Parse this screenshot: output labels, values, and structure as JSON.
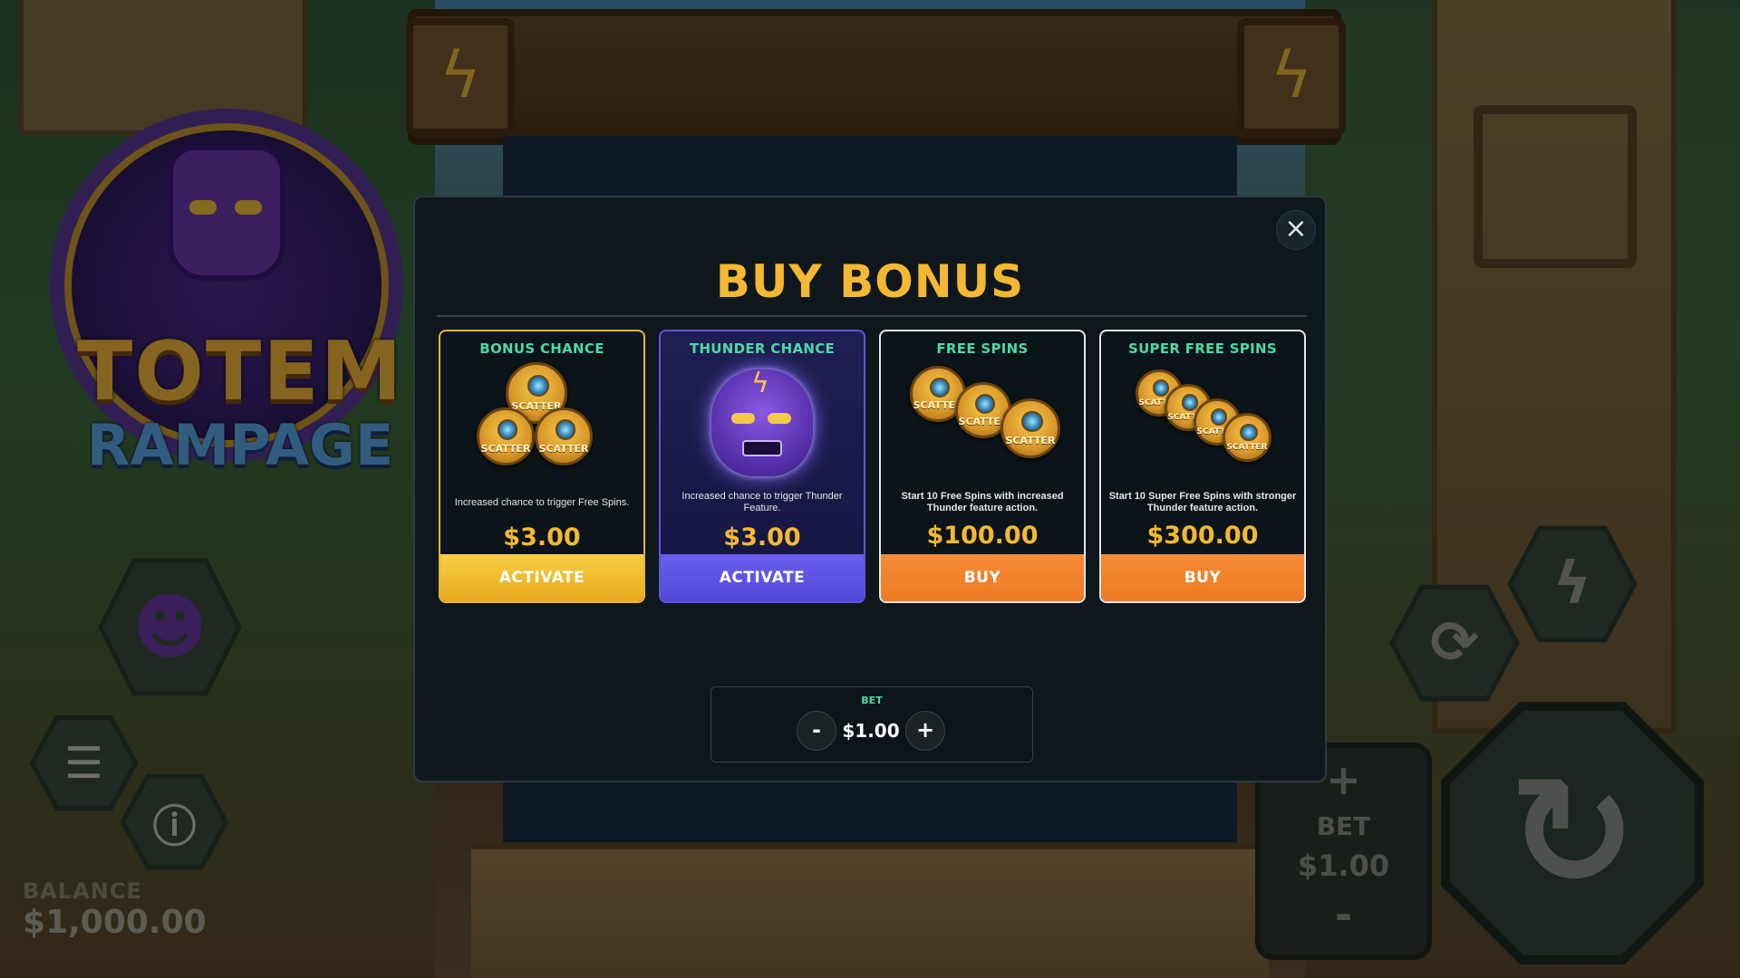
{
  "background": {
    "logo_line1": "TOTEM",
    "logo_line2": "RAMPAGE",
    "balance_label": "BALANCE",
    "balance_value": "$1,000.00",
    "bet_label": "BET",
    "bet_value": "$1.00",
    "bet_plus": "+",
    "bet_minus": "-"
  },
  "modal": {
    "title": "BUY BONUS",
    "close_icon": "×",
    "cards": [
      {
        "title": "BONUS CHANCE",
        "art": "scatter-coins-triangle-icon",
        "coin_labels": [
          "SCATTER",
          "SCATTER",
          "SCATTER"
        ],
        "description": "Increased chance to trigger Free Spins.",
        "price": "$3.00",
        "button": "ACTIVATE",
        "accent": "#e8b338"
      },
      {
        "title": "THUNDER CHANCE",
        "art": "thunder-totem-face-icon",
        "description": "Increased chance to trigger Thunder Feature.",
        "price": "$3.00",
        "button": "ACTIVATE",
        "accent": "#5e54e0"
      },
      {
        "title": "FREE SPINS",
        "art": "three-scatter-coins-icon",
        "coin_labels": [
          "SCATTER",
          "SCATTER",
          "SCATTER"
        ],
        "description": "Start 10 Free Spins with increased Thunder feature action.",
        "price": "$100.00",
        "button": "BUY",
        "accent": "#ee7a24"
      },
      {
        "title": "SUPER FREE SPINS",
        "art": "four-scatter-coins-icon",
        "coin_labels": [
          "SCATTER",
          "SCATTER",
          "SCATTER",
          "SCATTER"
        ],
        "description": "Start 10 Super Free Spins with stronger Thunder feature action.",
        "price": "$300.00",
        "button": "BUY",
        "accent": "#ee7a24"
      }
    ],
    "bet": {
      "label": "BET",
      "value": "$1.00",
      "minus": "-",
      "plus": "+"
    }
  },
  "colors": {
    "title_gold": "#f5b833",
    "card_title_green": "#4dd9a4",
    "modal_bg": "#0e181c"
  }
}
